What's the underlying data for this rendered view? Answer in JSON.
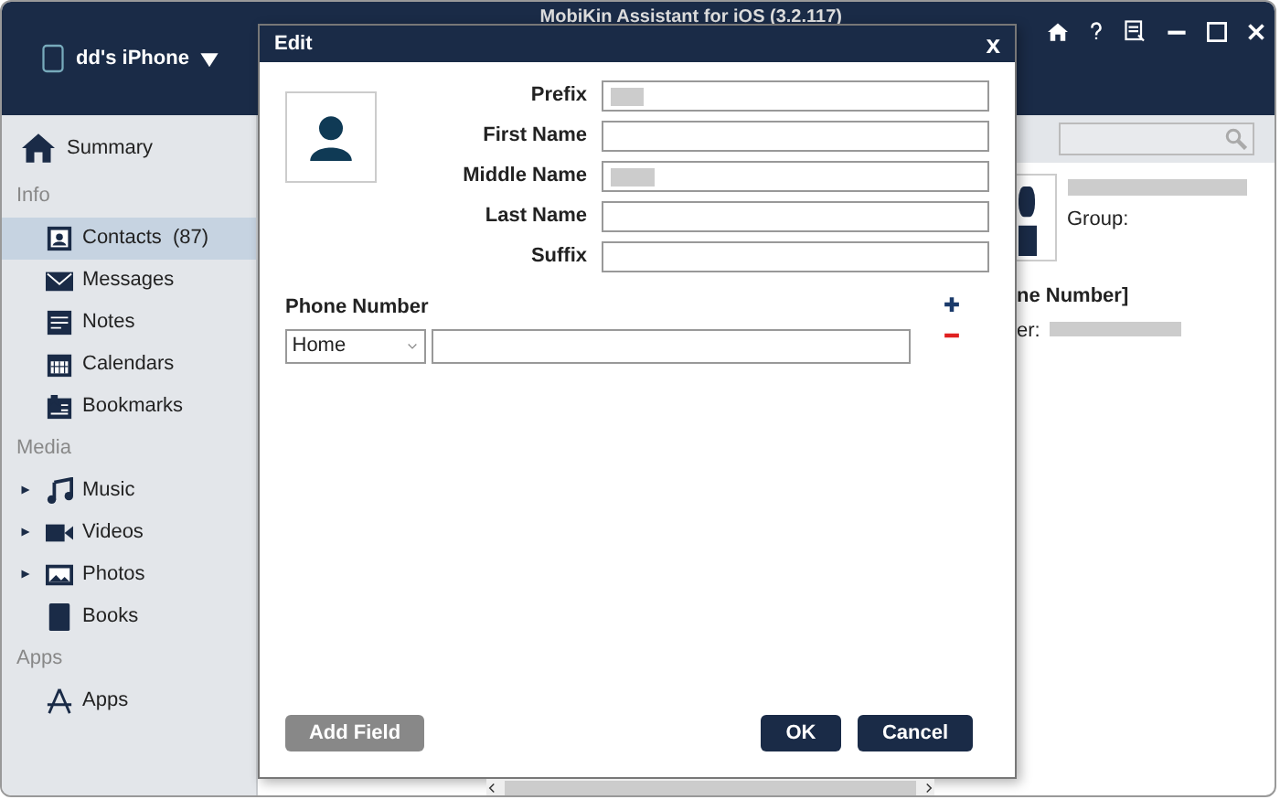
{
  "app": {
    "title": "MobiKin Assistant for iOS (3.2.117)",
    "device": "dd's iPhone"
  },
  "sidebar": [
    {
      "kind": "item",
      "label": "Summary",
      "selected": false
    },
    {
      "kind": "header",
      "label": "Info"
    },
    {
      "kind": "item",
      "label": "Contacts",
      "count": "(87)",
      "selected": true
    },
    {
      "kind": "item",
      "label": "Messages",
      "selected": false
    },
    {
      "kind": "item",
      "label": "Notes",
      "selected": false
    },
    {
      "kind": "item",
      "label": "Calendars",
      "selected": false
    },
    {
      "kind": "item",
      "label": "Bookmarks",
      "selected": false
    },
    {
      "kind": "header",
      "label": "Media"
    },
    {
      "kind": "item",
      "label": "Music",
      "expandable": true,
      "selected": false
    },
    {
      "kind": "item",
      "label": "Videos",
      "expandable": true,
      "selected": false
    },
    {
      "kind": "item",
      "label": "Photos",
      "expandable": true,
      "selected": false
    },
    {
      "kind": "item",
      "label": "Books",
      "expandable": false,
      "selected": false
    },
    {
      "kind": "header",
      "label": "Apps"
    },
    {
      "kind": "item",
      "label": "Apps",
      "expandable": false,
      "selected": false
    }
  ],
  "detail": {
    "group_label": "Group:",
    "section": "ne Number]",
    "phone_label": "er:"
  },
  "dialog": {
    "title": "Edit",
    "close": "x",
    "fields": [
      {
        "label": "Prefix",
        "redacted": true
      },
      {
        "label": "First Name",
        "redacted": false
      },
      {
        "label": "Middle Name",
        "redacted": true
      },
      {
        "label": "Last Name",
        "redacted": false
      },
      {
        "label": "Suffix",
        "redacted": false
      }
    ],
    "phone": {
      "label": "Phone Number",
      "type": "Home"
    },
    "buttons": [
      {
        "label": "Add Field",
        "kind": "secondary"
      },
      {
        "label": "OK",
        "kind": "primary"
      },
      {
        "label": "Cancel",
        "kind": "primary"
      }
    ]
  }
}
